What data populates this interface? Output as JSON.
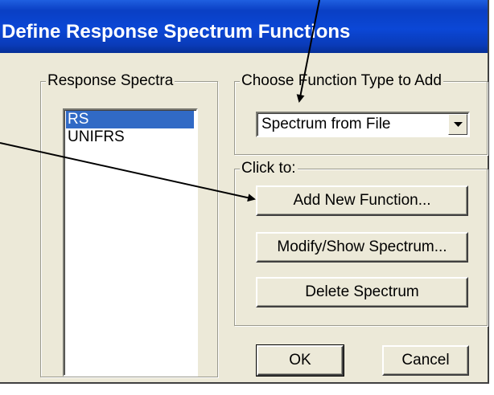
{
  "window": {
    "title": "Define Response Spectrum Functions"
  },
  "response_spectra": {
    "group_label": "Response Spectra",
    "items": [
      {
        "label": "RS",
        "selected": true
      },
      {
        "label": "UNIFRS",
        "selected": false
      }
    ]
  },
  "function_type": {
    "group_label": "Choose Function Type to Add",
    "selected_value": "Spectrum from File"
  },
  "click_to": {
    "group_label": "Click to:",
    "add_label": "Add New Function...",
    "modify_label": "Modify/Show Spectrum...",
    "delete_label": "Delete Spectrum"
  },
  "footer": {
    "ok_label": "OK",
    "cancel_label": "Cancel"
  },
  "colors": {
    "title_bar": "#0a3fc4",
    "dialog_face": "#ece9d8",
    "selection": "#316ac5"
  }
}
